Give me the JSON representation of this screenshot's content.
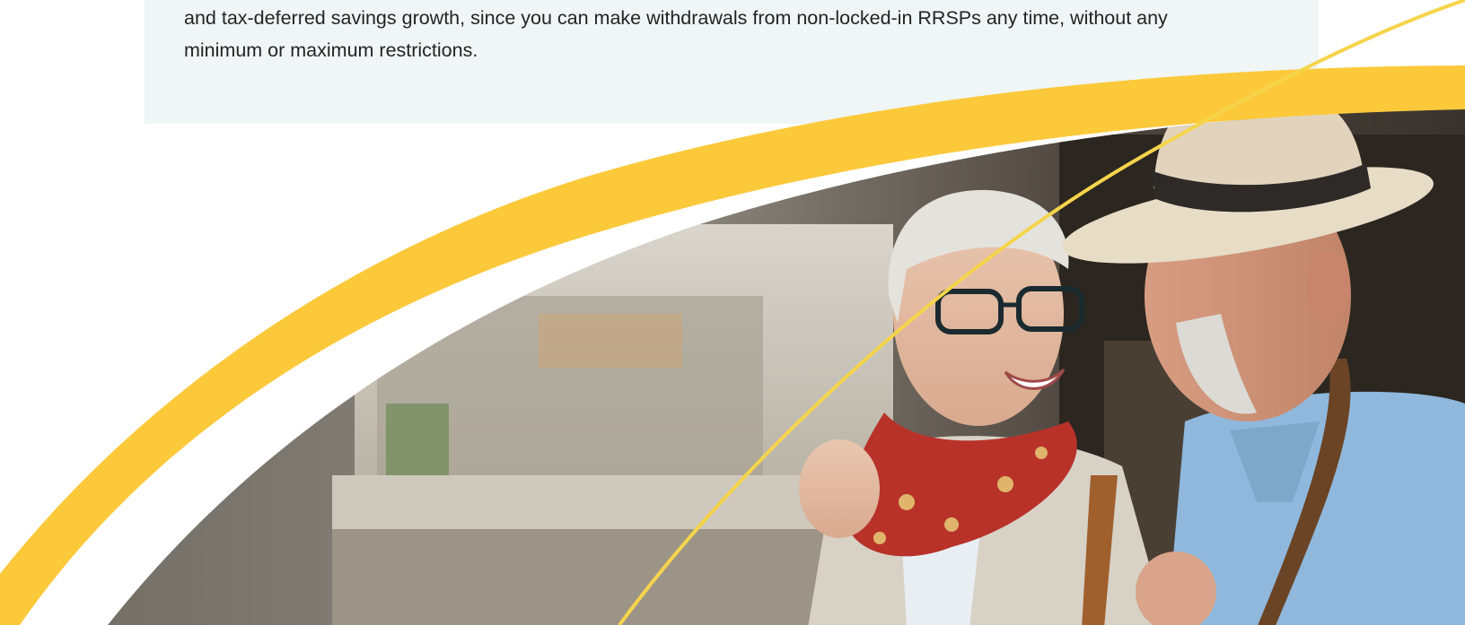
{
  "article": {
    "paragraph_line1": "and tax-deferred savings growth, since you can make withdrawals from non-locked-in RRSPs any time, without any",
    "paragraph_line2": "minimum or maximum restrictions."
  },
  "hero_image": {
    "description_name": "retired-couple-photo",
    "accent_color": "#FCC93B",
    "thin_line_color": "#F6D44B"
  }
}
